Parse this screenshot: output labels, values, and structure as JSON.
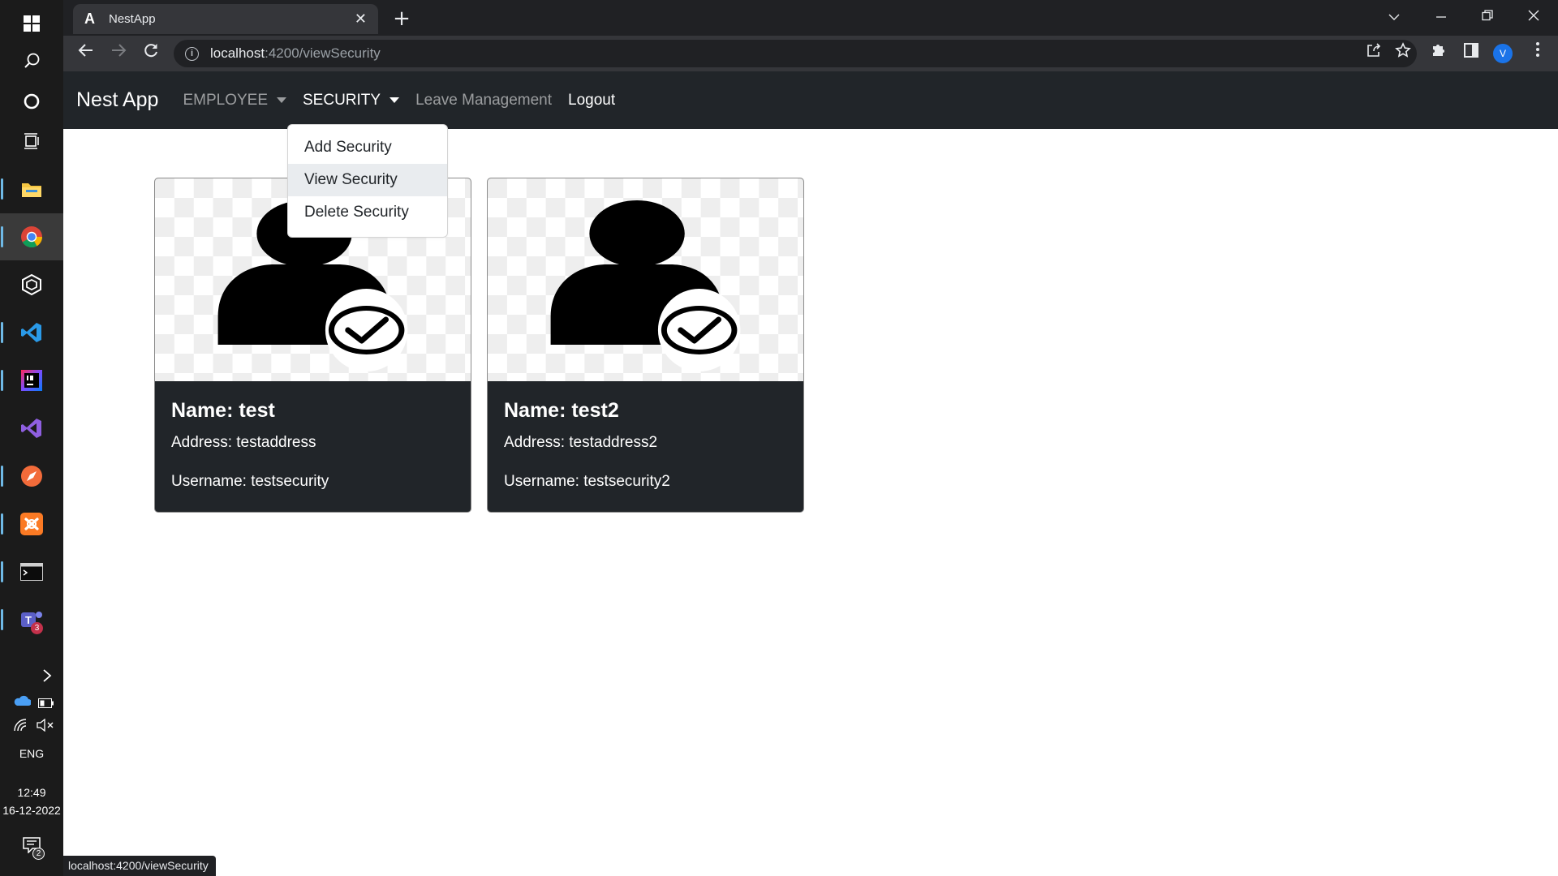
{
  "taskbar": {
    "language": "ENG",
    "time": "12:49",
    "date": "16-12-2022",
    "teams_badge": "3",
    "notifications_badge": "2",
    "icons": [
      "windows-start-icon",
      "search-icon",
      "cortana-icon",
      "task-view-icon",
      "file-explorer-icon",
      "chrome-icon",
      "cube-app-icon",
      "vscode-icon",
      "intellij-icon",
      "visual-studio-icon",
      "compass-app-icon",
      "xampp-icon",
      "terminal-icon",
      "teams-icon"
    ]
  },
  "browser": {
    "tab_title": "NestApp",
    "url_host": "localhost",
    "url_path": ":4200/viewSecurity",
    "profile_initial": "V",
    "status_url": "localhost:4200/viewSecurity"
  },
  "navbar": {
    "brand": "Nest App",
    "employee": "EMPLOYEE",
    "security": "SECURITY",
    "leave": "Leave Management",
    "logout": "Logout"
  },
  "dropdown": {
    "items": [
      "Add Security",
      "View Security",
      "Delete Security"
    ],
    "hovered_index": 1
  },
  "cards": [
    {
      "name": "Name: test",
      "address": "Address: testaddress",
      "username": "Username: testsecurity"
    },
    {
      "name": "Name: test2",
      "address": "Address: testaddress2",
      "username": "Username: testsecurity2"
    }
  ],
  "colors": {
    "navbar_bg": "#212529",
    "card_bg": "#212529",
    "chrome_bg": "#202124",
    "taskbar_bg": "#1b1b1b"
  }
}
